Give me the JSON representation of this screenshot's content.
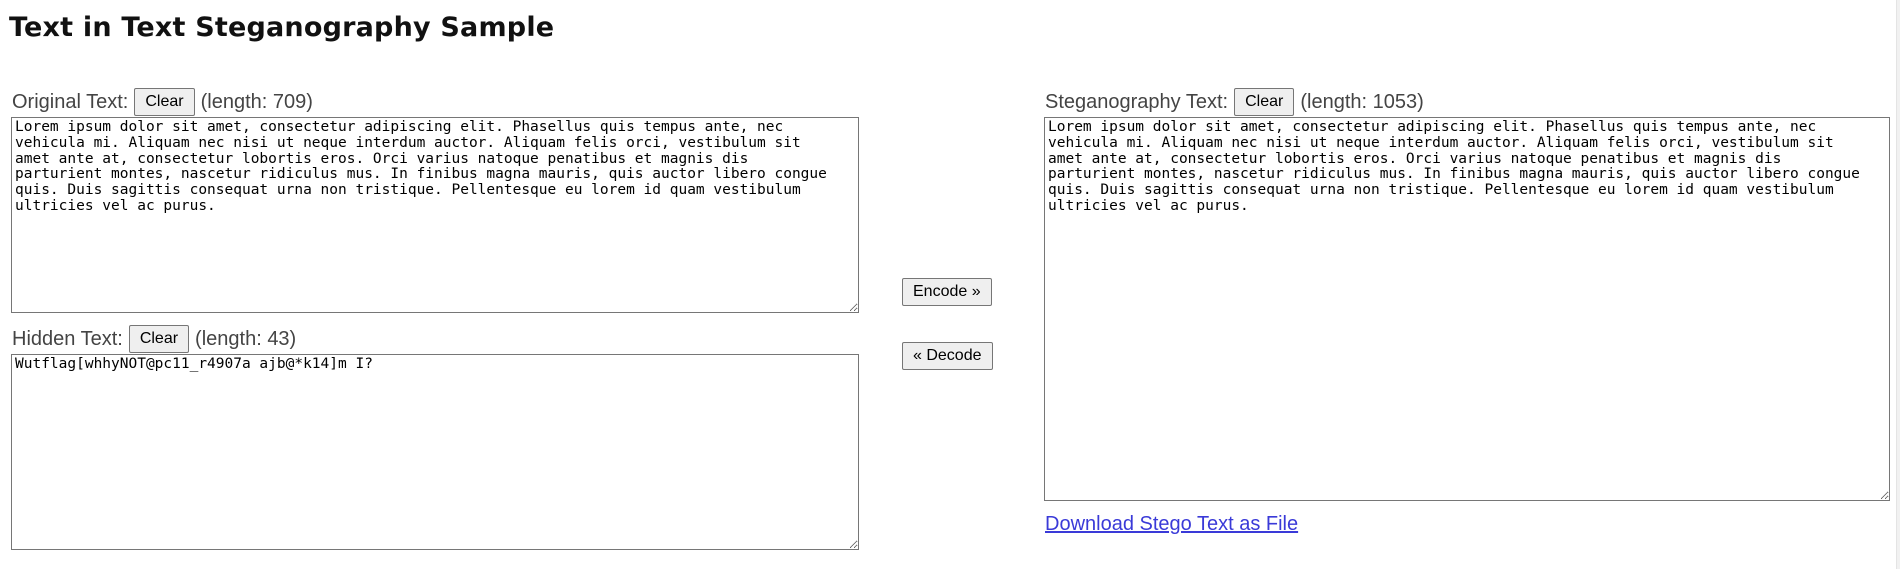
{
  "page": {
    "title": "Text in Text Steganography Sample"
  },
  "original": {
    "label": "Original Text:",
    "clear_label": "Clear",
    "length_text": "(length: 709)",
    "value": "Lorem ipsum dolor sit amet, consectetur adipiscing elit. Phasellus quis tempus ante, nec\nvehicula mi. Aliquam nec nisi ut neque interdum auctor. Aliquam felis orci, vestibulum sit\namet ante at, consectetur lobortis eros. Orci varius natoque penatibus et magnis dis\nparturient montes, nascetur ridiculus mus. In finibus magna mauris, quis auctor libero congue\nquis. Duis sagittis consequat urna non tristique. Pellentesque eu lorem id quam vestibulum\nultricies vel ac purus."
  },
  "hidden": {
    "label": "Hidden Text:",
    "clear_label": "Clear",
    "length_text": "(length: 43)",
    "value": "Wutflag[whhyNOT@pc11_r4907a ajb@*k14]m I?"
  },
  "actions": {
    "encode_label": "Encode »",
    "decode_label": "« Decode"
  },
  "stego": {
    "label": "Steganography Text:",
    "clear_label": "Clear",
    "length_text": "(length: 1053)",
    "value": "Lorem ipsum dolor sit amet, consectetur adipiscing elit. Phasellus quis tempus ante, nec\nvehicula mi. Aliquam nec nisi ut neque interdum auctor. Aliquam felis orci, vestibulum sit\namet ante at, consectetur lobortis eros. Orci varius natoque penatibus et magnis dis\nparturient montes, nascetur ridiculus mus. In finibus magna mauris, quis auctor libero congue\nquis. Duis sagittis consequat urna non tristique. Pellentesque eu lorem id quam vestibulum\nultricies vel ac purus.",
    "download_label": "Download Stego Text as File"
  },
  "colors": {
    "link": "#3a3ad8",
    "button_bg": "#efefef",
    "border": "#767676"
  }
}
